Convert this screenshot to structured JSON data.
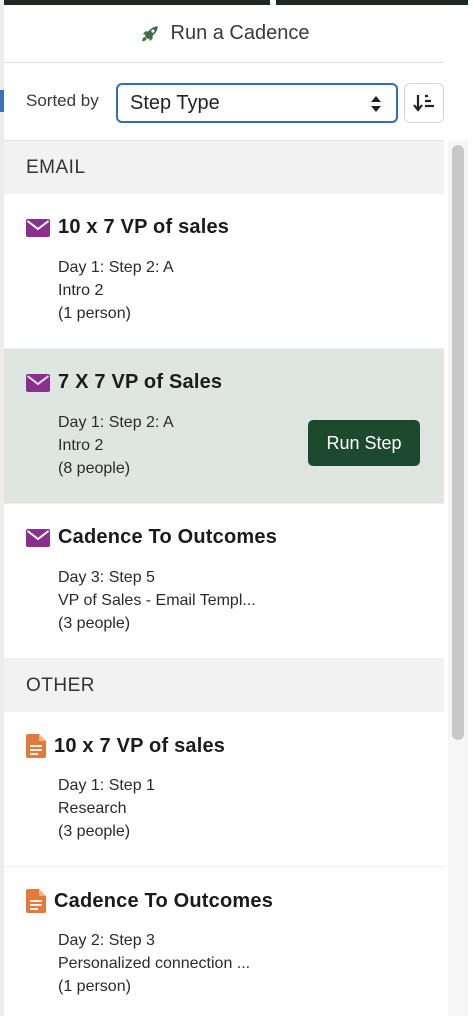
{
  "header": {
    "title": "Run a Cadence",
    "icon": "rocket-icon"
  },
  "sort": {
    "label": "Sorted by",
    "selected": "Step Type",
    "button_icon": "sort-descending-icon"
  },
  "sections": [
    {
      "label": "EMAIL",
      "icon": "mail-icon",
      "color": "#8b2f8e",
      "items": [
        {
          "title_number": "10 x 7",
          "title_rest": " VP of sales",
          "line1": "Day 1: Step 2: A",
          "line2": "Intro 2",
          "line3": "(1 person)"
        },
        {
          "title_number": "7 X 7",
          "title_rest": " VP of Sales",
          "line1": "Day 1: Step 2: A",
          "line2": "Intro 2",
          "line3": "(8 people)",
          "action": "Run Step"
        },
        {
          "title_number": "",
          "title_rest": "Cadence To Outcomes",
          "line1": "Day 3: Step 5",
          "line2": "VP of Sales - Email Templ...",
          "line3": "(3 people)"
        }
      ]
    },
    {
      "label": "OTHER",
      "icon": "document-icon",
      "color": "#e07b3c",
      "items": [
        {
          "title_number": "10 x 7",
          "title_rest": " VP of sales",
          "line1": "Day 1: Step 1",
          "line2": "Research",
          "line3": "(3 people)"
        },
        {
          "title_number": "",
          "title_rest": "Cadence To Outcomes",
          "line1": "Day 2: Step 3",
          "line2": "Personalized connection ...",
          "line3": "(1 person)"
        }
      ]
    }
  ],
  "colors": {
    "accent": "#1d4a2f",
    "focus": "#2f6dbf",
    "rocket": "#3f6b48"
  }
}
